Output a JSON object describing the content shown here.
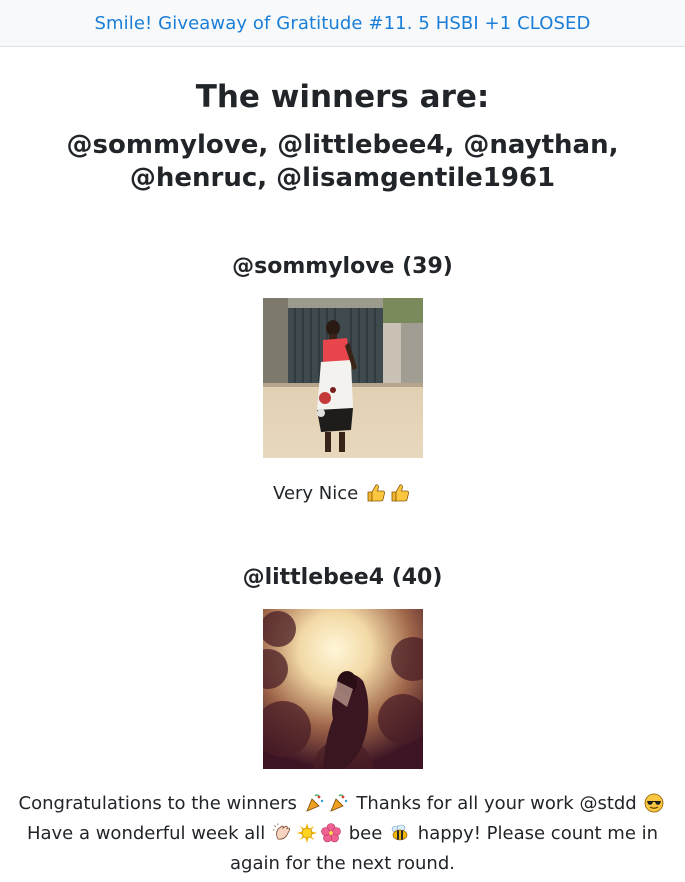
{
  "nav": {
    "title": "Smile! Giveaway of Gratitude #11. 5 HSBI +1 CLOSED"
  },
  "main": {
    "heading": "The winners are:",
    "winners_line1": "@sommylove, @littlebee4, @naythan,",
    "winners_line2": "@henruc, @lisamgentile1961",
    "entries": [
      {
        "name": "@sommylove (39)",
        "caption": "Very Nice",
        "caption_icons": [
          "thumbs-up-icon",
          "thumbs-up-icon"
        ]
      },
      {
        "name": "@littlebee4 (40)"
      }
    ]
  },
  "footer": {
    "part1": "Congratulations to the winners",
    "part2": "Thanks for all your work @stdd",
    "part3": "Have a wonderful week all",
    "part4": "bee",
    "part5": "happy! Please count me in again for the next round."
  },
  "colors": {
    "link": "#1a7ed8",
    "nav_bg": "#f8f9fa",
    "text": "#212529"
  }
}
